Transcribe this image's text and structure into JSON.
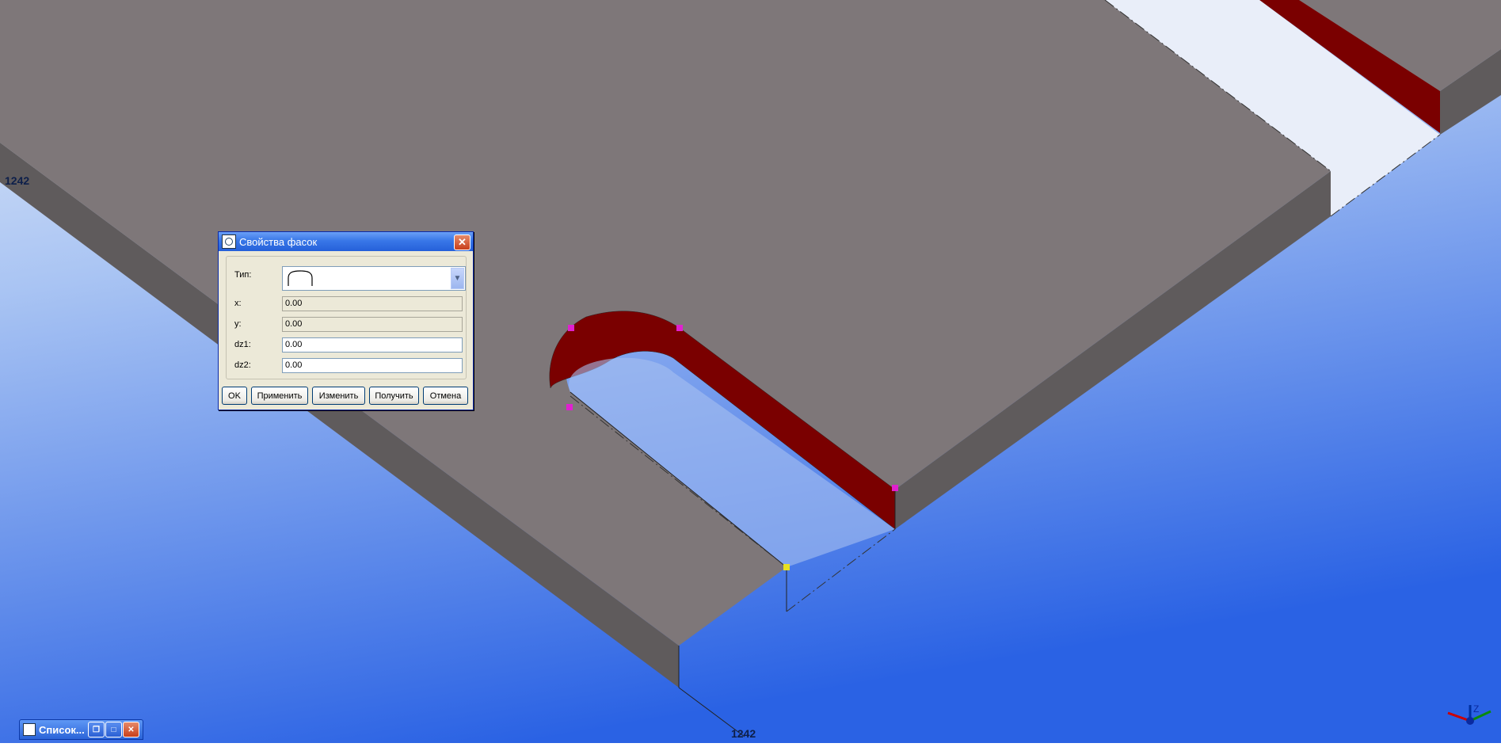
{
  "viewport": {
    "dim_label_left": "1242",
    "dim_label_bottom": "1242",
    "axis_label": "Z"
  },
  "dialog": {
    "title": "Свойства фасок",
    "type_label": "Тип:",
    "fields": [
      {
        "label": "x:",
        "value": "0.00",
        "editable": false
      },
      {
        "label": "y:",
        "value": "0.00",
        "editable": false
      },
      {
        "label": "dz1:",
        "value": "0.00",
        "editable": true
      },
      {
        "label": "dz2:",
        "value": "0.00",
        "editable": true
      }
    ],
    "buttons": {
      "ok": "OK",
      "apply": "Применить",
      "modify": "Изменить",
      "get": "Получить",
      "cancel": "Отмена"
    }
  },
  "minimized": {
    "title": "Список..."
  },
  "colors": {
    "plate_top": "#7e7779",
    "plate_side": "#5c5859",
    "chamfer_red": "#7a0000",
    "bg_top": "#dbe6f6",
    "bg_bottom": "#2e66e6",
    "handle_magenta": "#e020d0",
    "handle_yellow": "#e8e020"
  }
}
